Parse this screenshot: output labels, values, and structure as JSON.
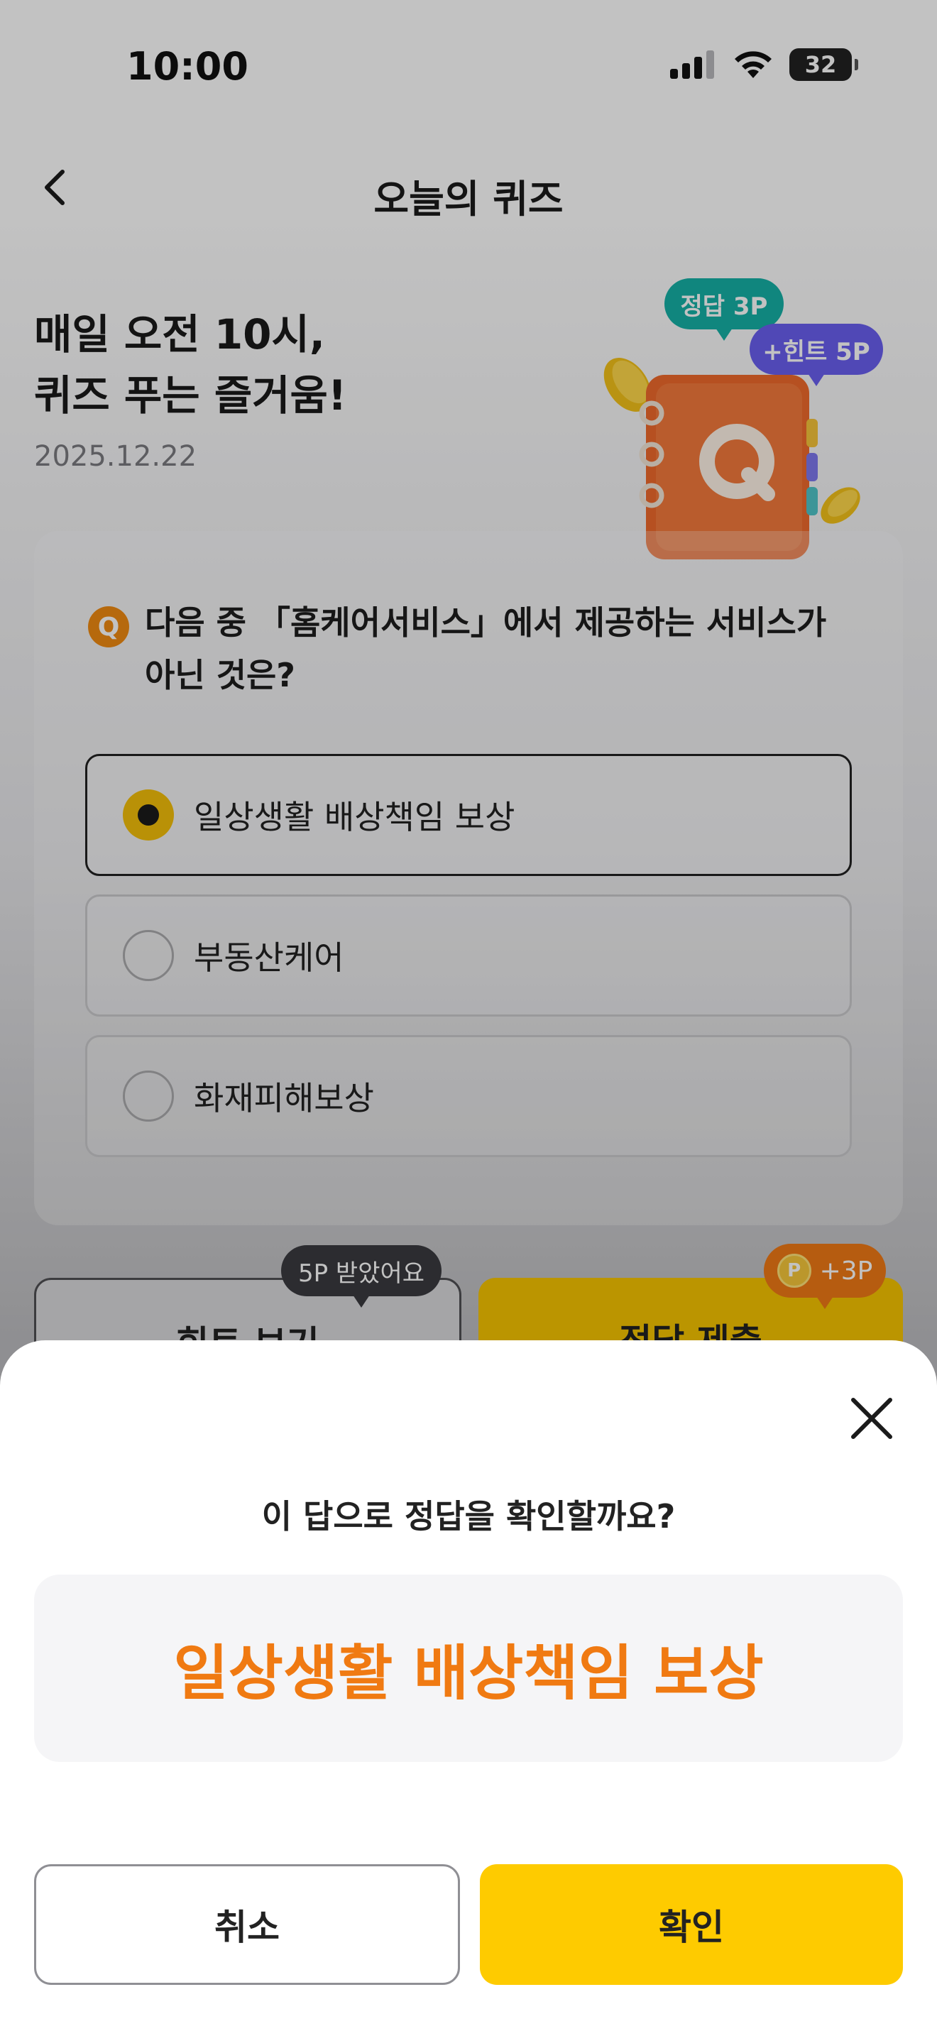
{
  "status_bar": {
    "time": "10:00",
    "battery": "32"
  },
  "nav": {
    "title": "오늘의 퀴즈"
  },
  "hero": {
    "title_line1": "매일 오전 10시,",
    "title_line2": "퀴즈 푸는 즐거움!",
    "date": "2025.12.22",
    "bubble_answer": "정답 3P",
    "bubble_hint": "+힌트 5P",
    "notebook_letter": "Q"
  },
  "quiz": {
    "badge": "Q",
    "question": "다음 중 「홈케어서비스」에서 제공하는 서비스가 아닌 것은?",
    "options": [
      {
        "label": "일상생활 배상책임 보상",
        "selected": true
      },
      {
        "label": "부동산케어",
        "selected": false
      },
      {
        "label": "화재피해보상",
        "selected": false
      }
    ]
  },
  "actions": {
    "hint_label": "힌트 보기",
    "hint_tooltip": "5P 받았어요",
    "submit_label": "정답 제출",
    "submit_tooltip": "+3P",
    "coin_letter": "P"
  },
  "sheet": {
    "question": "이 답으로 정답을 확인할까요?",
    "answer": "일상생활 배상책임 보상",
    "cancel_label": "취소",
    "confirm_label": "확인"
  },
  "colors": {
    "accent_yellow": "#fecb00",
    "answer_orange": "#f07a12",
    "teal": "#16b0a6",
    "purple": "#6a5ff0"
  }
}
